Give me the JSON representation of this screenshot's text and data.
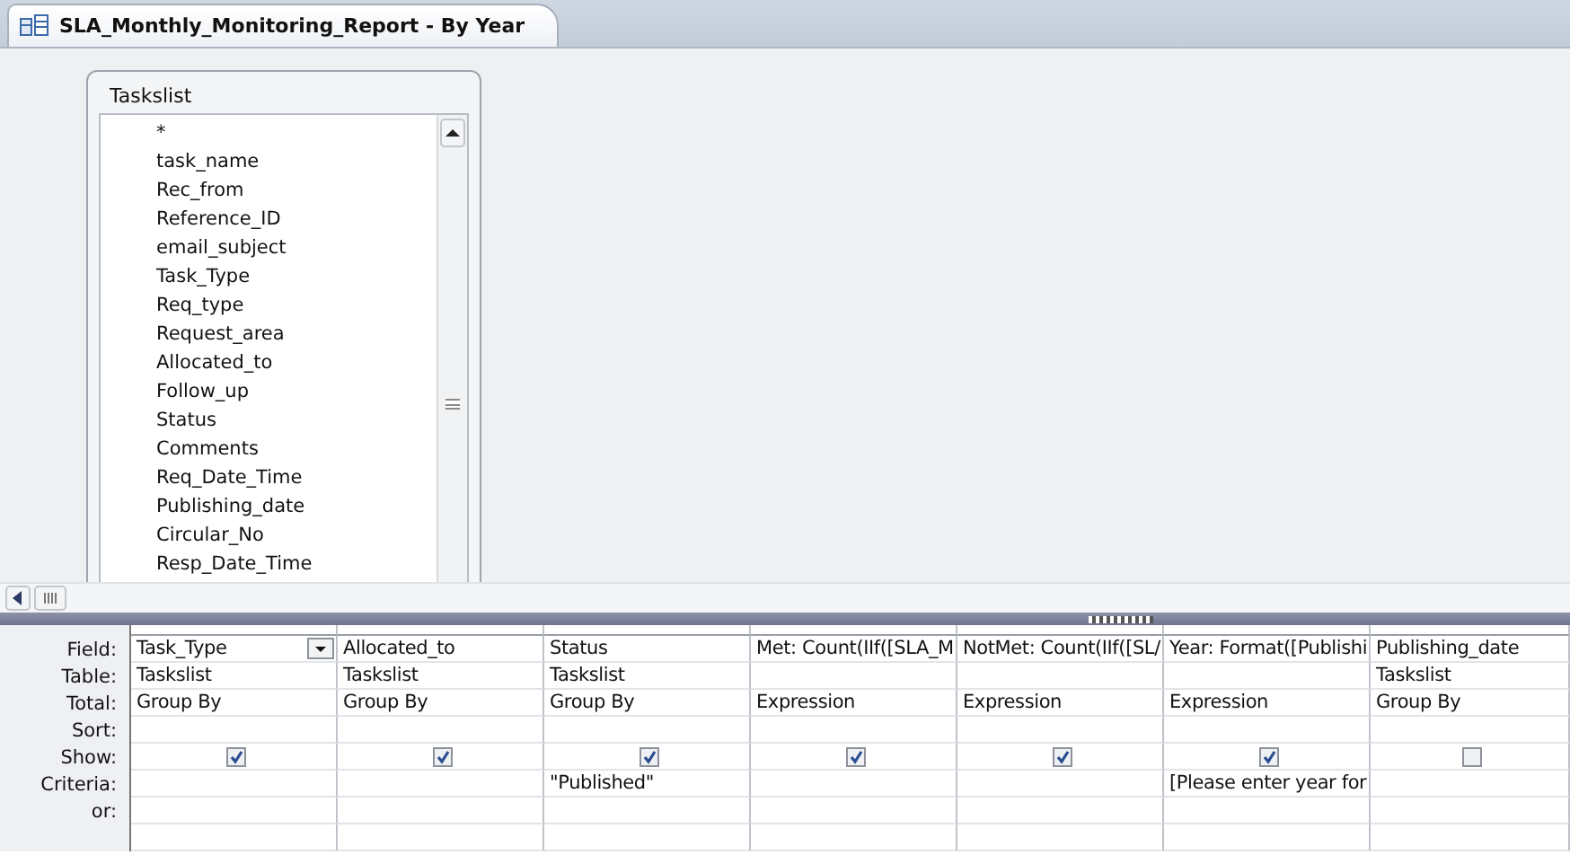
{
  "window": {
    "title": "SLA_Monthly_Monitoring_Report - By Year"
  },
  "table_box": {
    "title": "Taskslist",
    "fields": [
      "*",
      "task_name",
      "Rec_from",
      "Reference_ID",
      "email_subject",
      "Task_Type",
      "Req_type",
      "Request_area",
      "Allocated_to",
      "Follow_up",
      "Status",
      "Comments",
      "Req_Date_Time",
      "Publishing_date",
      "Circular_No",
      "Resp_Date_Time"
    ]
  },
  "grid": {
    "row_labels": [
      "Field:",
      "Table:",
      "Total:",
      "Sort:",
      "Show:",
      "Criteria:",
      "or:"
    ],
    "columns": [
      {
        "field": "Task_Type",
        "table": "Taskslist",
        "total": "Group By",
        "show": true,
        "focused": true
      },
      {
        "field": "Allocated_to",
        "table": "Taskslist",
        "total": "Group By",
        "show": true,
        "focused": false
      },
      {
        "field": "Status",
        "table": "Taskslist",
        "total": "Group By",
        "show": true,
        "criteria": "\"Published\"",
        "focused": false
      },
      {
        "field": "Met: Count(IIf([SLA_M",
        "total": "Expression",
        "show": true,
        "focused": false
      },
      {
        "field": "NotMet: Count(IIf([SL/",
        "total": "Expression",
        "show": true,
        "focused": false
      },
      {
        "field": "Year: Format([Publishi",
        "total": "Expression",
        "show": true,
        "criteria": "[Please enter year for",
        "focused": false
      },
      {
        "field": "Publishing_date",
        "table": "Taskslist",
        "total": "Group By",
        "show": false,
        "focused": false
      }
    ]
  }
}
